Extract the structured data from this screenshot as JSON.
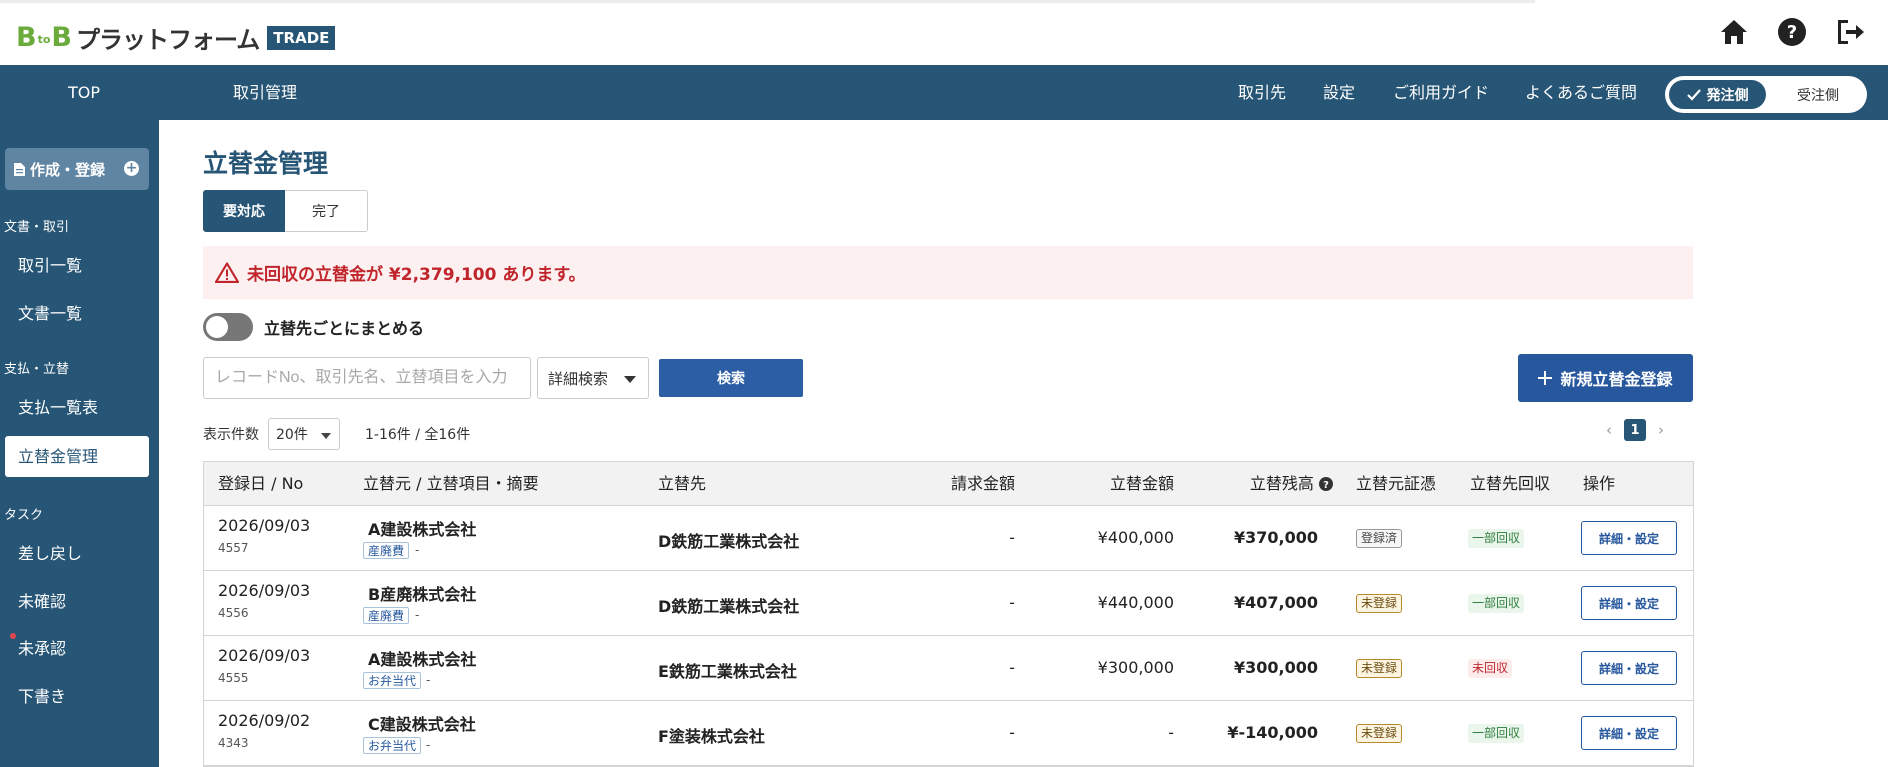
{
  "header": {
    "logo": {
      "b1": "B",
      "to": "to",
      "b2": "B",
      "platform": "プラットフォーム",
      "badge": "TRADE"
    },
    "icons": [
      "home-icon",
      "help-icon",
      "logout-icon"
    ]
  },
  "nav": {
    "top": "TOP",
    "transactions": "取引管理",
    "clients": "取引先",
    "settings": "設定",
    "guide": "ご利用ガイド",
    "faq": "よくあるご質問",
    "mode_on": "発注側",
    "mode_off": "受注側"
  },
  "sidebar": {
    "create": "作成・登録",
    "section1": "文書・取引",
    "item_transactions": "取引一覧",
    "item_documents": "文書一覧",
    "section2": "支払・立替",
    "item_payments": "支払一覧表",
    "item_advances": "立替金管理",
    "section3": "タスク",
    "item_returned": "差し戻し",
    "item_unconfirmed": "未確認",
    "item_unapproved": "未承認",
    "item_drafts": "下書き"
  },
  "main": {
    "title": "立替金管理",
    "tab_active": "要対応",
    "tab_done": "完了",
    "alert": "未回収の立替金が ¥2,379,100 あります。",
    "group_toggle": "立替先ごとにまとめる",
    "search_placeholder": "レコードNo、取引先名、立替項目を入力",
    "adv_search": "詳細検索",
    "search_btn": "検索",
    "new_btn": "新規立替金登録",
    "per_page_label": "表示件数",
    "per_page_value": "20件",
    "range": "1-16件 / 全16件",
    "page": "1"
  },
  "table": {
    "headers": {
      "date": "登録日 / No",
      "source": "立替元 / 立替項目・摘要",
      "payee": "立替先",
      "bill": "請求金額",
      "amount": "立替金額",
      "balance": "立替残高",
      "voucher": "立替元証憑",
      "recovery": "立替先回収",
      "action": "操作"
    },
    "rows": [
      {
        "date": "2026/09/03",
        "no": "4557",
        "company": "A建設株式会社",
        "tag": "産廃費",
        "memo": "-",
        "payee": "D鉄筋工業株式会社",
        "bill": "-",
        "amount": "¥400,000",
        "balance": "¥370,000",
        "voucher": "登録済",
        "recovery": "一部回収",
        "action": "詳細・設定"
      },
      {
        "date": "2026/09/03",
        "no": "4556",
        "company": "B産廃株式会社",
        "tag": "産廃費",
        "memo": "-",
        "payee": "D鉄筋工業株式会社",
        "bill": "-",
        "amount": "¥440,000",
        "balance": "¥407,000",
        "voucher": "未登録",
        "recovery": "一部回収",
        "action": "詳細・設定"
      },
      {
        "date": "2026/09/03",
        "no": "4555",
        "company": "A建設株式会社",
        "tag": "お弁当代",
        "memo": "-",
        "payee": "E鉄筋工業株式会社",
        "bill": "-",
        "amount": "¥300,000",
        "balance": "¥300,000",
        "voucher": "未登録",
        "recovery": "未回収",
        "action": "詳細・設定"
      },
      {
        "date": "2026/09/02",
        "no": "4343",
        "company": "C建設株式会社",
        "tag": "お弁当代",
        "memo": "-",
        "payee": "F塗装株式会社",
        "bill": "-",
        "amount": "-",
        "balance": "¥-140,000",
        "voucher": "未登録",
        "recovery": "一部回収",
        "action": "詳細・設定"
      }
    ]
  },
  "colors": {
    "brand": "#275575",
    "accent": "#2c5ea6",
    "alert": "#c0252c",
    "logo_green": "#6aab3c"
  }
}
